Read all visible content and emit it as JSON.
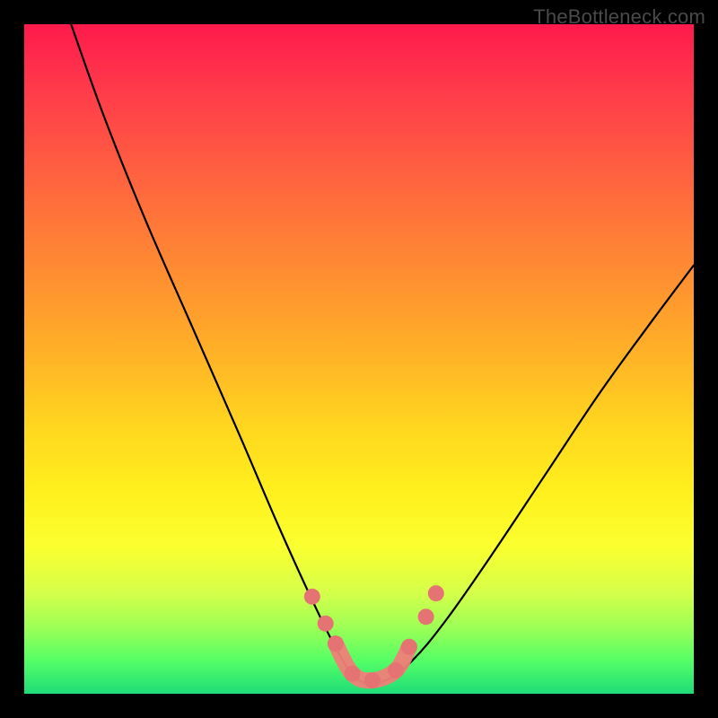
{
  "watermark": "TheBottleneck.com",
  "chart_data": {
    "type": "line",
    "title": "",
    "xlabel": "",
    "ylabel": "",
    "xlim": [
      0,
      1
    ],
    "ylim": [
      0,
      1
    ],
    "series": [
      {
        "name": "bottleneck-curve",
        "x": [
          0.07,
          0.12,
          0.18,
          0.25,
          0.32,
          0.38,
          0.43,
          0.47,
          0.5,
          0.54,
          0.58,
          0.63,
          0.7,
          0.78,
          0.86,
          0.94,
          1.0
        ],
        "values": [
          1.0,
          0.86,
          0.71,
          0.55,
          0.39,
          0.25,
          0.14,
          0.06,
          0.02,
          0.02,
          0.05,
          0.11,
          0.21,
          0.33,
          0.45,
          0.56,
          0.64
        ]
      }
    ],
    "markers": {
      "name": "highlight-dots",
      "color": "#e57373",
      "points_x": [
        0.43,
        0.45,
        0.465,
        0.49,
        0.52,
        0.555,
        0.575,
        0.6,
        0.615
      ],
      "points_y": [
        0.145,
        0.105,
        0.075,
        0.03,
        0.02,
        0.035,
        0.07,
        0.115,
        0.15
      ]
    },
    "gradient_colors": {
      "top": "#ff1a4d",
      "mid": "#fff01e",
      "bottom": "#1edc78"
    }
  }
}
